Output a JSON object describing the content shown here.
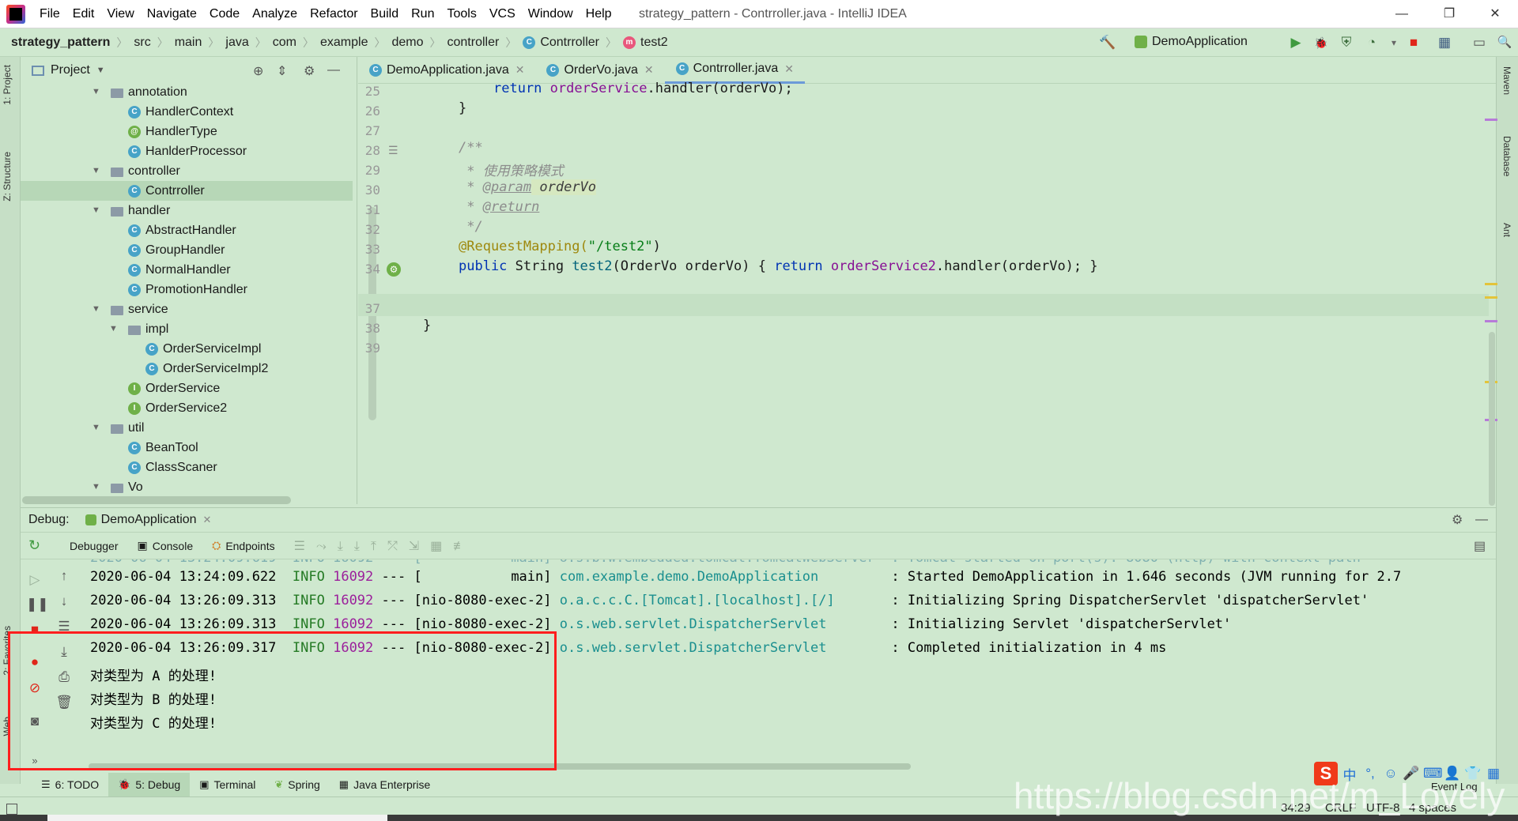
{
  "menubar": {
    "items": [
      "File",
      "Edit",
      "View",
      "Navigate",
      "Code",
      "Analyze",
      "Refactor",
      "Build",
      "Run",
      "Tools",
      "VCS",
      "Window",
      "Help"
    ],
    "window_title": "strategy_pattern - Contrroller.java - IntelliJ IDEA",
    "minimize": "—",
    "restore": "❐",
    "close": "✕"
  },
  "breadcrumb": {
    "project": "strategy_pattern",
    "parts": [
      "src",
      "main",
      "java",
      "com",
      "example",
      "demo",
      "controller"
    ],
    "class_badge": "C",
    "class_name": "Contrroller",
    "method_badge": "m",
    "method_name": "test2"
  },
  "toolbar": {
    "run_config": "DemoApplication",
    "hammer_icon": "🔨",
    "run_icon": "▶",
    "debug_icon": "🐞",
    "stop_icon": "■",
    "search_icon": "🔍"
  },
  "left_strip": {
    "project_tab": "1: Project",
    "structure_tab": "Z: Structure",
    "favorites_tab": "2: Favorites",
    "web_tab": "Web"
  },
  "right_strip": {
    "maven_tab": "Maven",
    "database_tab": "Database",
    "ant_tab": "Ant"
  },
  "project": {
    "header_label": "Project",
    "tree": [
      {
        "label": "annotation",
        "type": "folder",
        "level": 0,
        "open": true
      },
      {
        "label": "HandlerContext",
        "type": "class",
        "level": 1
      },
      {
        "label": "HandlerType",
        "type": "annotation",
        "level": 1
      },
      {
        "label": "HanlderProcessor",
        "type": "class",
        "level": 1
      },
      {
        "label": "controller",
        "type": "folder",
        "level": 0,
        "open": true
      },
      {
        "label": "Contrroller",
        "type": "class",
        "level": 1,
        "selected": true
      },
      {
        "label": "handler",
        "type": "folder",
        "level": 0,
        "open": true
      },
      {
        "label": "AbstractHandler",
        "type": "class",
        "level": 1
      },
      {
        "label": "GroupHandler",
        "type": "class",
        "level": 1
      },
      {
        "label": "NormalHandler",
        "type": "class",
        "level": 1
      },
      {
        "label": "PromotionHandler",
        "type": "class",
        "level": 1
      },
      {
        "label": "service",
        "type": "folder",
        "level": 0,
        "open": true
      },
      {
        "label": "impl",
        "type": "folder",
        "level": 1,
        "open": true
      },
      {
        "label": "OrderServiceImpl",
        "type": "class",
        "level": 2
      },
      {
        "label": "OrderServiceImpl2",
        "type": "class",
        "level": 2
      },
      {
        "label": "OrderService",
        "type": "interface",
        "level": 1
      },
      {
        "label": "OrderService2",
        "type": "interface",
        "level": 1
      },
      {
        "label": "util",
        "type": "folder",
        "level": 0,
        "open": true
      },
      {
        "label": "BeanTool",
        "type": "class",
        "level": 1
      },
      {
        "label": "ClassScaner",
        "type": "class",
        "level": 1
      },
      {
        "label": "Vo",
        "type": "folder",
        "level": 0,
        "open": true
      }
    ]
  },
  "editor": {
    "tabs": [
      {
        "label": "DemoApplication.java",
        "active": false
      },
      {
        "label": "OrderVo.java",
        "active": false
      },
      {
        "label": "Contrroller.java",
        "active": true
      }
    ],
    "line_numbers": [
      "25",
      "26",
      "27",
      "28",
      "29",
      "30",
      "31",
      "32",
      "33",
      "34",
      "37",
      "38",
      "39"
    ],
    "code": {
      "l25_kw": "return ",
      "l25_fld": "orderService",
      "l25_rest": ".handler(orderVo);",
      "l26": "}",
      "l28": "/**",
      "l29": " * 使用策略模式",
      "l30_tag": "@param",
      "l30_param": " orderVo",
      "l31_tag": "@return",
      "l32": " */",
      "l33_ann": "@RequestMapping(",
      "l33_str": "\"/test2\"",
      "l33_end": ")",
      "l34_kw1": "public ",
      "l34_type": "String ",
      "l34_mth": "test2",
      "l34_args": "(OrderVo orderVo) { ",
      "l34_kw2": "return ",
      "l34_fld": "orderService2",
      "l34_rest": ".handler(orderVo); }",
      "l38": "}"
    }
  },
  "debug": {
    "label": "Debug:",
    "config": "DemoApplication",
    "tabs": [
      {
        "label": "Debugger"
      },
      {
        "label": "Console"
      },
      {
        "label": "Endpoints"
      }
    ],
    "log_lines": [
      {
        "time": "2020-06-04 13:24:09.622",
        "level": "INFO",
        "pid": "16092",
        "sep": "---",
        "thread": "[           main]",
        "logger": "com.example.demo.DemoApplication        ",
        "msg": ": Started DemoApplication in 1.646 seconds (JVM running for 2.7"
      },
      {
        "time": "2020-06-04 13:26:09.313",
        "level": "INFO",
        "pid": "16092",
        "sep": "---",
        "thread": "[nio-8080-exec-2]",
        "logger": "o.a.c.c.C.[Tomcat].[localhost].[/]      ",
        "msg": ": Initializing Spring DispatcherServlet 'dispatcherServlet'"
      },
      {
        "time": "2020-06-04 13:26:09.313",
        "level": "INFO",
        "pid": "16092",
        "sep": "---",
        "thread": "[nio-8080-exec-2]",
        "logger": "o.s.web.servlet.DispatcherServlet       ",
        "msg": ": Initializing Servlet 'dispatcherServlet'"
      },
      {
        "time": "2020-06-04 13:26:09.317",
        "level": "INFO",
        "pid": "16092",
        "sep": "---",
        "thread": "[nio-8080-exec-2]",
        "logger": "o.s.web.servlet.DispatcherServlet       ",
        "msg": ": Completed initialization in 4 ms"
      }
    ],
    "output_lines": [
      "对类型为 A 的处理!",
      "对类型为 B 的处理!",
      "对类型为 C 的处理!"
    ]
  },
  "bottom_tabs": [
    {
      "label": "6: TODO",
      "active": false
    },
    {
      "label": "5: Debug",
      "active": true
    },
    {
      "label": "Terminal",
      "active": false
    },
    {
      "label": "Spring",
      "active": false
    },
    {
      "label": "Java Enterprise",
      "active": false
    }
  ],
  "status_bar": {
    "position": "34:29",
    "line_sep": "CRLF",
    "encoding": "UTF-8",
    "indent": "4 spaces",
    "event_log": "Event Log"
  },
  "ime": {
    "logo": "S",
    "lang": "中"
  },
  "watermark": "https://blog.csdn.net/m_Lovely"
}
